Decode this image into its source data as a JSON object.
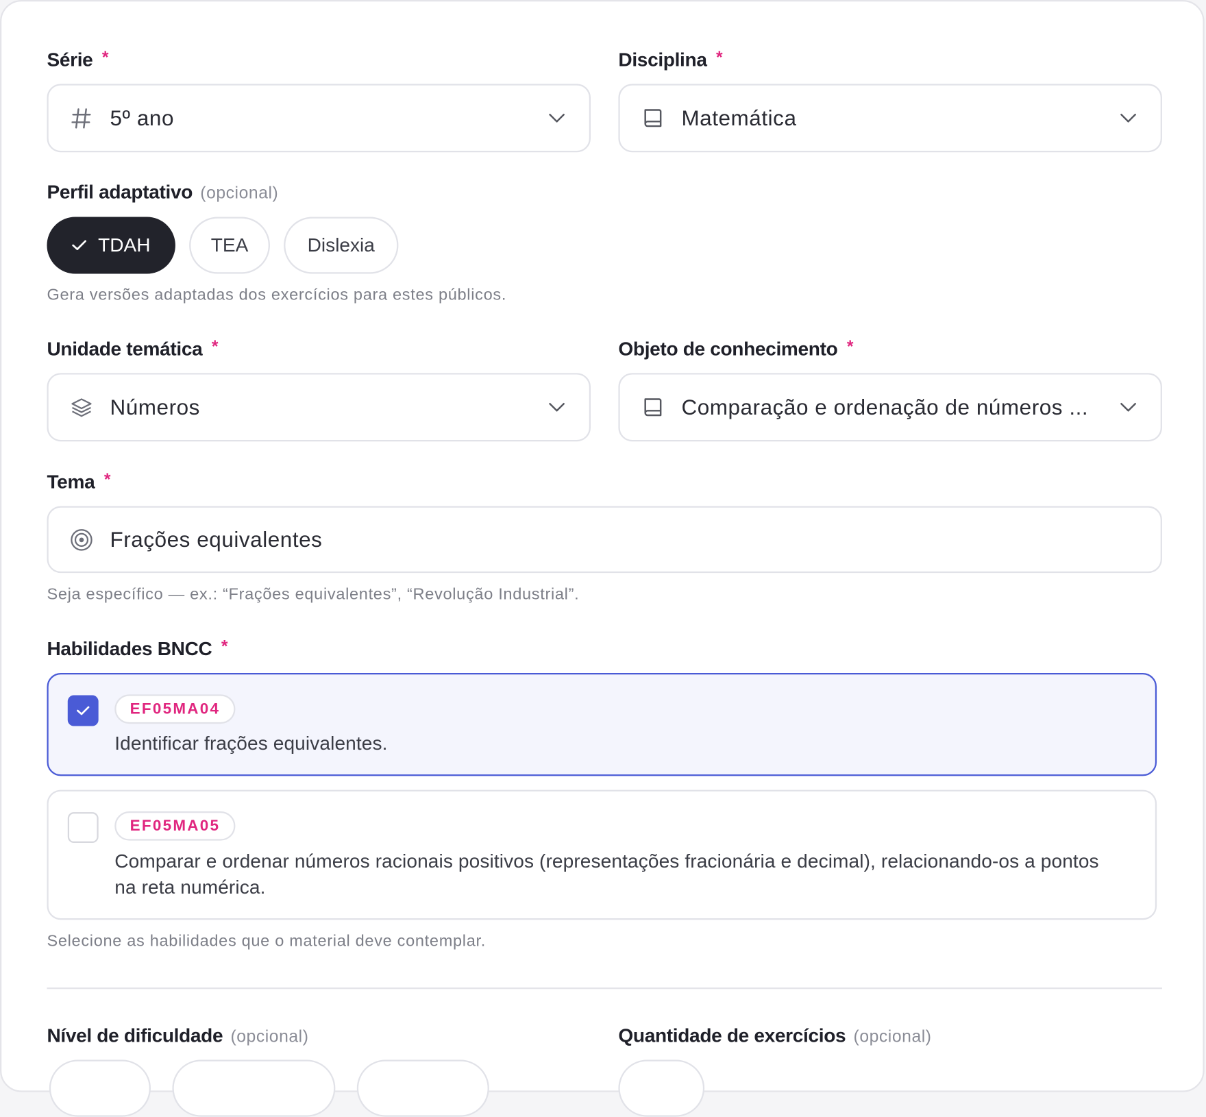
{
  "serie": {
    "label": "Série",
    "required": "*",
    "value": "5º ano",
    "icon": "hash-icon"
  },
  "disciplina": {
    "label": "Disciplina",
    "required": "*",
    "value": "Matemática",
    "icon": "book-icon"
  },
  "perfil": {
    "label": "Perfil adaptativo",
    "optional": "(opcional)",
    "chips": [
      {
        "label": "TDAH",
        "selected": true
      },
      {
        "label": "TEA",
        "selected": false
      },
      {
        "label": "Dislexia",
        "selected": false
      }
    ],
    "help": "Gera versões adaptadas dos exercícios para estes públicos."
  },
  "unidade": {
    "label": "Unidade temática",
    "required": "*",
    "value": "Números",
    "icon": "layers-icon"
  },
  "objeto": {
    "label": "Objeto de conhecimento",
    "required": "*",
    "value": "Comparação e ordenação de números ...",
    "icon": "book-icon"
  },
  "tema": {
    "label": "Tema",
    "required": "*",
    "value": "Frações equivalentes",
    "icon": "target-icon",
    "help": "Seja específico — ex.: “Frações equivalentes”, “Revolução Industrial”."
  },
  "habilidades": {
    "label": "Habilidades BNCC",
    "required": "*",
    "items": [
      {
        "code": "EF05MA04",
        "text": "Identificar frações equivalentes.",
        "checked": true
      },
      {
        "code": "EF05MA05",
        "text": "Comparar e ordenar números racionais positivos (representações fracionária e decimal), relacionando-os a pontos na reta numérica.",
        "checked": false
      }
    ],
    "help": "Selecione as habilidades que o material deve contemplar."
  },
  "nivel": {
    "label": "Nível de dificuldade",
    "optional": "(opcional)"
  },
  "quantidade": {
    "label": "Quantidade de exercícios",
    "optional": "(opcional)"
  },
  "colors": {
    "accent": "#4a5bd6",
    "required": "#e0267f",
    "chip_active": "#22232b",
    "border": "#e1e2e8"
  }
}
